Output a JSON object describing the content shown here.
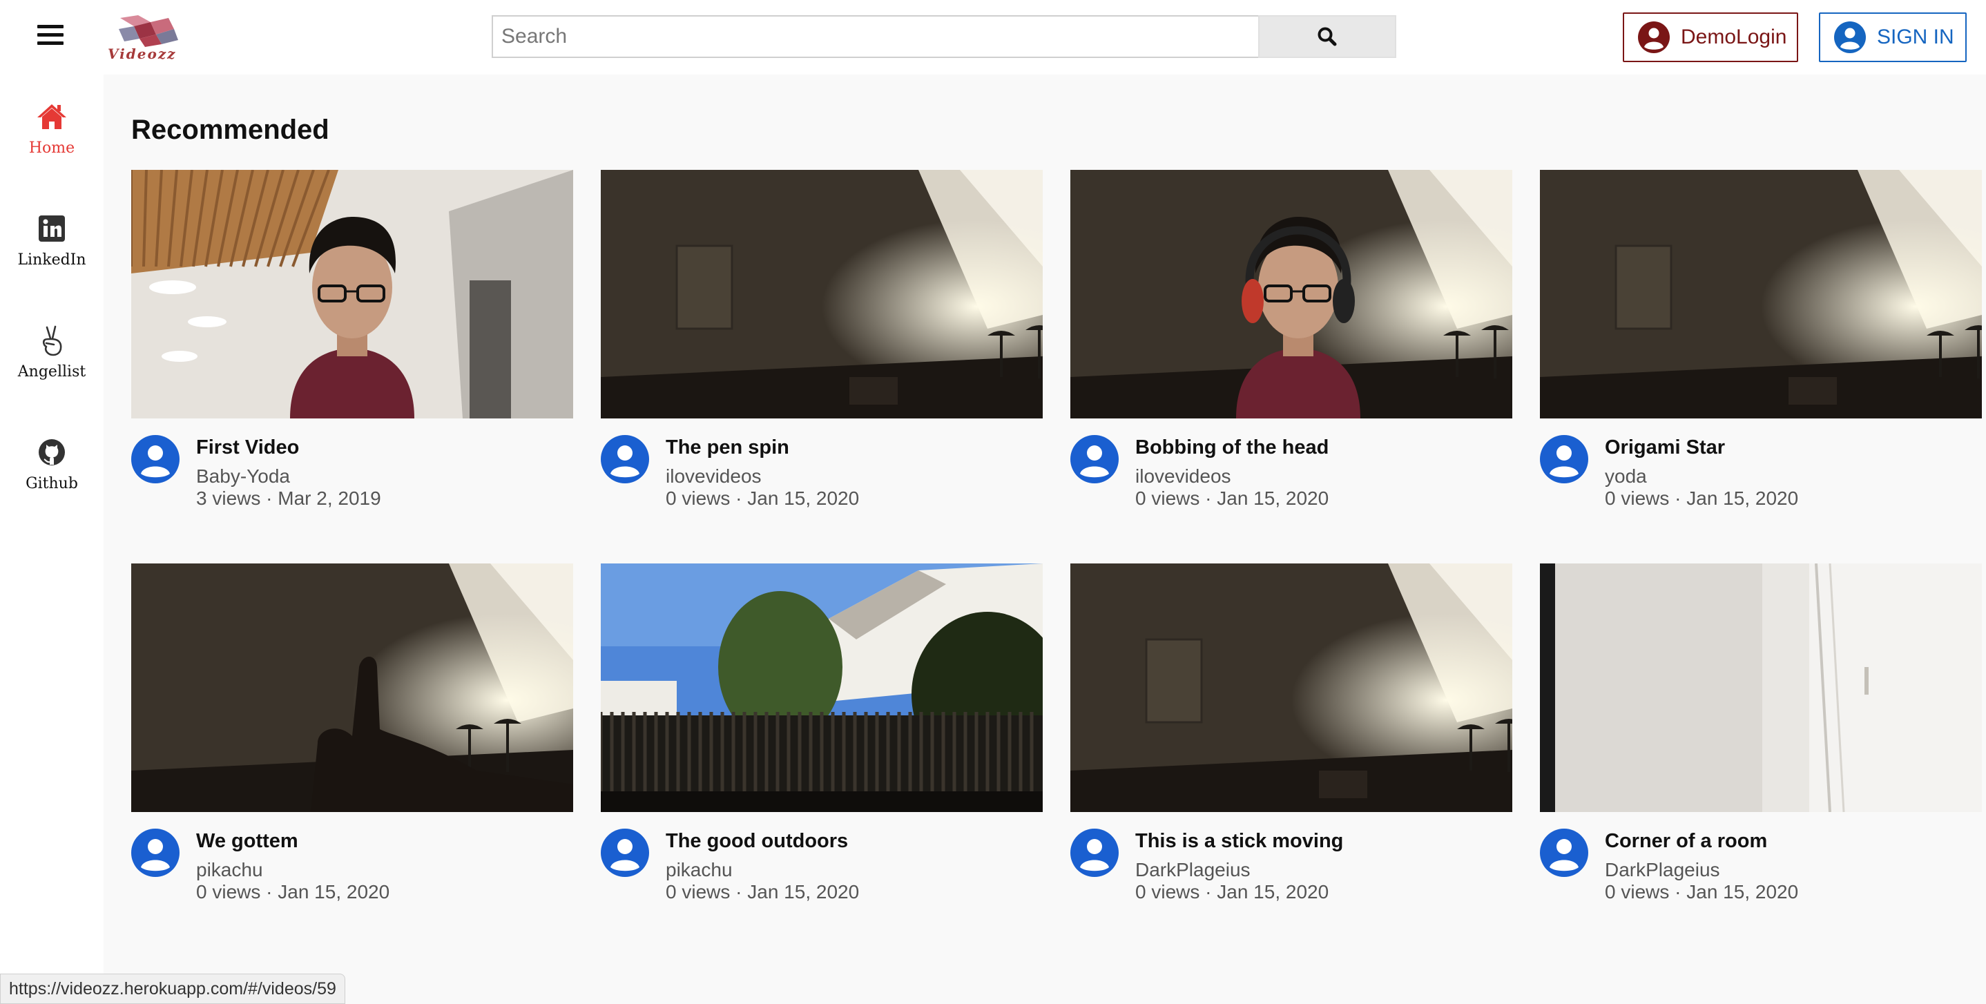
{
  "header": {
    "logo_text": "Videozz",
    "search_placeholder": "Search",
    "demo_login_label": "DemoLogin",
    "sign_in_label": "SIGN IN"
  },
  "sidebar": {
    "items": [
      {
        "label": "Home",
        "icon": "home-icon",
        "active": true
      },
      {
        "label": "LinkedIn",
        "icon": "linkedin-icon",
        "active": false
      },
      {
        "label": "Angellist",
        "icon": "angellist-icon",
        "active": false
      },
      {
        "label": "Github",
        "icon": "github-icon",
        "active": false
      }
    ]
  },
  "main": {
    "heading": "Recommended",
    "videos": [
      {
        "title": "First Video",
        "channel": "Baby-Yoda",
        "meta": "3 views · Mar 2, 2019",
        "thumbnail": "person-in-room"
      },
      {
        "title": "The pen spin",
        "channel": "ilovevideos",
        "meta": "0 views · Jan 15, 2020",
        "thumbnail": "dim-room-lamp"
      },
      {
        "title": "Bobbing of the head",
        "channel": "ilovevideos",
        "meta": "0 views · Jan 15, 2020",
        "thumbnail": "person-headphones"
      },
      {
        "title": "Origami Star",
        "channel": "yoda",
        "meta": "0 views · Jan 15, 2020",
        "thumbnail": "dim-room-lamp"
      },
      {
        "title": "We gottem",
        "channel": "pikachu",
        "meta": "0 views · Jan 15, 2020",
        "thumbnail": "thumbs-up"
      },
      {
        "title": "The good outdoors",
        "channel": "pikachu",
        "meta": "0 views · Jan 15, 2020",
        "thumbnail": "outdoors"
      },
      {
        "title": "This is a stick moving",
        "channel": "DarkPlageius",
        "meta": "0 views · Jan 15, 2020",
        "thumbnail": "dim-room-lamp"
      },
      {
        "title": "Corner of a room",
        "channel": "DarkPlageius",
        "meta": "0 views · Jan 15, 2020",
        "thumbnail": "door-corner"
      }
    ]
  },
  "status_bar": {
    "url": "https://videozz.herokuapp.com/#/videos/59"
  },
  "colors": {
    "brand_red": "#e53935",
    "demo_login": "#7a1616",
    "sign_in_blue": "#1565c0",
    "avatar_blue": "#1a5fd0"
  }
}
